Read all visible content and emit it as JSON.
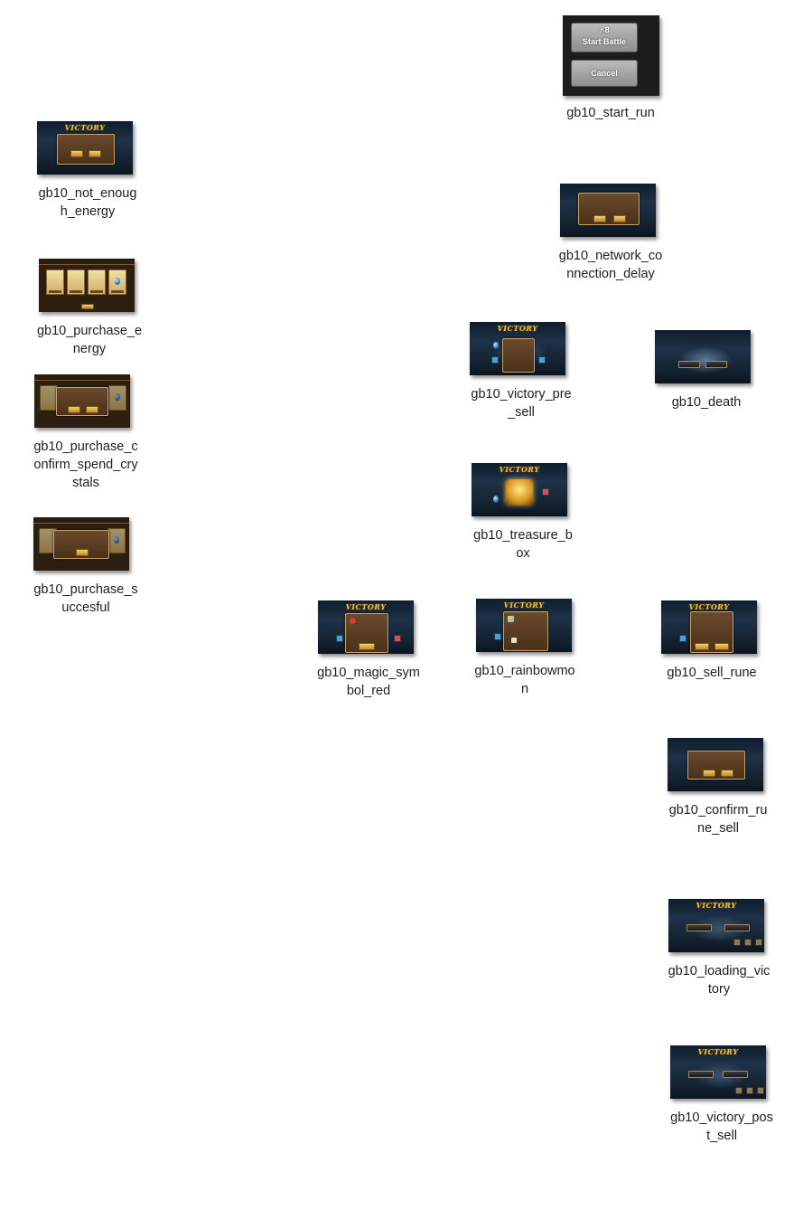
{
  "files": [
    {
      "name": "gb10_start_run",
      "label": "gb10_start_run",
      "thumb": {
        "top_text": "8",
        "btn1": "Start Battle",
        "btn2": "Cancel"
      }
    },
    {
      "name": "gb10_not_enough_energy",
      "label": "gb10_not_enoug\nh_energy",
      "thumb": {
        "title": "VICTORY"
      }
    },
    {
      "name": "gb10_network_connection_delay",
      "label": "gb10_network_co\nnnection_delay",
      "thumb": {}
    },
    {
      "name": "gb10_purchase_energy",
      "label": "gb10_purchase_e\nnergy",
      "thumb": {}
    },
    {
      "name": "gb10_victory_pre_sell",
      "label": "gb10_victory_pre\n_sell",
      "thumb": {
        "title": "VICTORY"
      }
    },
    {
      "name": "gb10_death",
      "label": "gb10_death",
      "thumb": {}
    },
    {
      "name": "gb10_purchase_confirm_spend_crystals",
      "label": "gb10_purchase_c\nonfirm_spend_cry\nstals",
      "thumb": {}
    },
    {
      "name": "gb10_treasure_box",
      "label": "gb10_treasure_b\nox",
      "thumb": {
        "title": "VICTORY"
      }
    },
    {
      "name": "gb10_purchase_succesful",
      "label": "gb10_purchase_s\nuccesful",
      "thumb": {}
    },
    {
      "name": "gb10_magic_symbol_red",
      "label": "gb10_magic_sym\nbol_red",
      "thumb": {
        "title": "VICTORY"
      }
    },
    {
      "name": "gb10_rainbowmon",
      "label": "gb10_rainbowmo\nn",
      "thumb": {
        "title": "VICTORY"
      }
    },
    {
      "name": "gb10_sell_rune",
      "label": "gb10_sell_rune",
      "thumb": {
        "title": "VICTORY"
      }
    },
    {
      "name": "gb10_confirm_rune_sell",
      "label": "gb10_confirm_ru\nne_sell",
      "thumb": {}
    },
    {
      "name": "gb10_loading_victory",
      "label": "gb10_loading_vic\ntory",
      "thumb": {
        "title": "VICTORY"
      }
    },
    {
      "name": "gb10_victory_post_sell",
      "label": "gb10_victory_pos\nt_sell",
      "thumb": {
        "title": "VICTORY"
      }
    }
  ]
}
